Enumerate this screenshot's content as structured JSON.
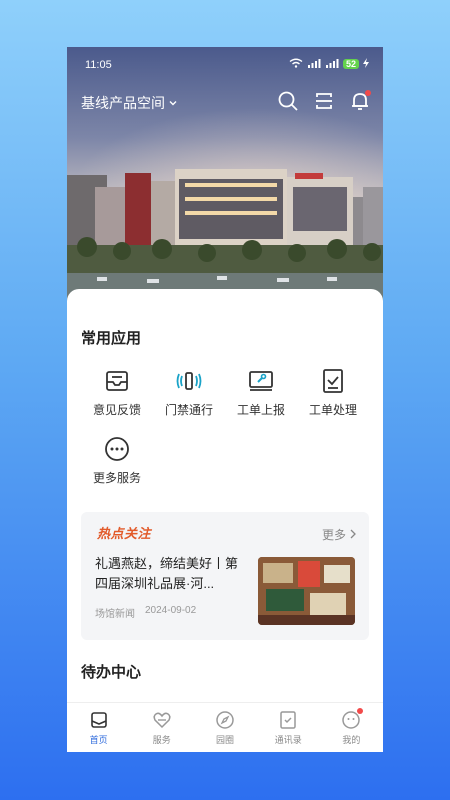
{
  "status_bar": {
    "time": "11:05",
    "network": "5G",
    "battery": "52"
  },
  "header": {
    "space_name": "基线产品空间"
  },
  "common_apps": {
    "title": "常用应用",
    "items": [
      {
        "label": "意见反馈",
        "icon": "feedback-icon"
      },
      {
        "label": "门禁通行",
        "icon": "access-control-icon"
      },
      {
        "label": "工单上报",
        "icon": "work-order-report-icon"
      },
      {
        "label": "工单处理",
        "icon": "work-order-process-icon"
      },
      {
        "label": "更多服务",
        "icon": "more-services-icon"
      }
    ]
  },
  "hot_news": {
    "brand": "热点关注",
    "more": "更多",
    "title": "礼遇燕赵，缔结美好丨第四届深圳礼品展·河...",
    "source": "场馆新闻",
    "date": "2024-09-02"
  },
  "todo": {
    "title": "待办中心"
  },
  "tabbar": {
    "items": [
      {
        "label": "首页",
        "icon": "home-icon",
        "active": true
      },
      {
        "label": "服务",
        "icon": "service-icon",
        "active": false
      },
      {
        "label": "园圈",
        "icon": "compass-icon",
        "active": false
      },
      {
        "label": "通讯录",
        "icon": "contacts-icon",
        "active": false
      },
      {
        "label": "我的",
        "icon": "profile-icon",
        "active": false
      }
    ]
  },
  "colors": {
    "accent": "#2f6bdc",
    "brand": "#e25a2a",
    "badge": "#f24a4a"
  }
}
